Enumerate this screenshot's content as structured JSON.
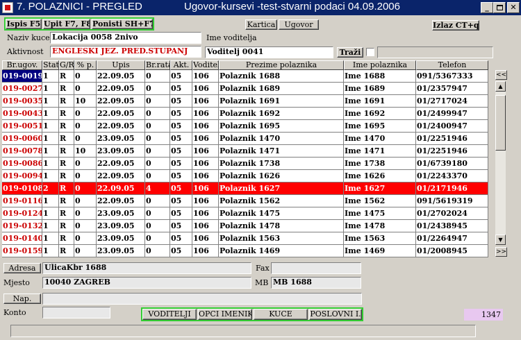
{
  "window": {
    "title_left": "7. POLAZNICI - PREGLED",
    "title_right": "Ugovor-kursevi -test-stvarni podaci 04.09.2006",
    "min_label": "_",
    "max_label": "□",
    "close_label": "✕"
  },
  "toolbar": {
    "ispis": "Ispis F5",
    "upit": "Upit F7, F8",
    "ponisti": "Ponisti SH+F7",
    "kartica": "Kartica",
    "ugovor": "Ugovor",
    "izlaz": "Izlaz CT+q"
  },
  "header_form": {
    "naziv_kuce_label": "Naziv kuce",
    "naziv_kuce_value": "Lokacija 0058 2nivo",
    "ime_voditelja_label": "Ime voditelja",
    "aktivnost_label": "Aktivnost",
    "aktivnost_value": "ENGLESKI JEZ. PRED.STUPANJ",
    "voditelj_value": "Voditelj 0041",
    "trazi_label": "Traži"
  },
  "table": {
    "columns": [
      "Br.ugov.",
      "Stat.",
      "G/R",
      "% p.",
      "Upis",
      "Br.rata",
      "Akt.",
      "Voditelj",
      "Prezime polaznika",
      "Ime polaznika",
      "Telefon"
    ],
    "rows": [
      [
        "019-0019",
        "1",
        "R",
        "0",
        "22.09.05",
        "0",
        "05",
        "106",
        "Polaznik 1688",
        "Ime 1688",
        "091/5367333"
      ],
      [
        "019-0027",
        "1",
        "R",
        "0",
        "22.09.05",
        "0",
        "05",
        "106",
        "Polaznik 1689",
        "Ime 1689",
        "01/2357947"
      ],
      [
        "019-0035",
        "1",
        "R",
        "10",
        "22.09.05",
        "0",
        "05",
        "106",
        "Polaznik 1691",
        "Ime 1691",
        "01/2717024"
      ],
      [
        "019-0043",
        "1",
        "R",
        "0",
        "22.09.05",
        "0",
        "05",
        "106",
        "Polaznik 1692",
        "Ime 1692",
        "01/2499947"
      ],
      [
        "019-0051",
        "1",
        "R",
        "0",
        "22.09.05",
        "0",
        "05",
        "106",
        "Polaznik 1695",
        "Ime 1695",
        "01/2400947"
      ],
      [
        "019-0060",
        "1",
        "R",
        "0",
        "23.09.05",
        "0",
        "05",
        "106",
        "Polaznik 1470",
        "Ime 1470",
        "01/2251946"
      ],
      [
        "019-0078",
        "1",
        "R",
        "10",
        "23.09.05",
        "0",
        "05",
        "106",
        "Polaznik 1471",
        "Ime 1471",
        "01/2251946"
      ],
      [
        "019-0086",
        "1",
        "R",
        "0",
        "22.09.05",
        "0",
        "05",
        "106",
        "Polaznik 1738",
        "Ime 1738",
        "01/6739180"
      ],
      [
        "019-0094",
        "1",
        "R",
        "0",
        "22.09.05",
        "0",
        "05",
        "106",
        "Polaznik 1626",
        "Ime 1626",
        "01/2243370"
      ],
      [
        "019-0108",
        "2",
        "R",
        "0",
        "22.09.05",
        "4",
        "05",
        "106",
        "Polaznik 1627",
        "Ime 1627",
        "01/2171946"
      ],
      [
        "019-0116",
        "1",
        "R",
        "0",
        "22.09.05",
        "0",
        "05",
        "106",
        "Polaznik 1562",
        "Ime 1562",
        "091/5619319"
      ],
      [
        "019-0124",
        "1",
        "R",
        "0",
        "23.09.05",
        "0",
        "05",
        "106",
        "Polaznik 1475",
        "Ime 1475",
        "01/2702024"
      ],
      [
        "019-0132",
        "1",
        "R",
        "0",
        "23.09.05",
        "0",
        "05",
        "106",
        "Polaznik 1478",
        "Ime 1478",
        "01/2438945"
      ],
      [
        "019-0140",
        "1",
        "R",
        "0",
        "23.09.05",
        "0",
        "05",
        "106",
        "Polaznik 1563",
        "Ime 1563",
        "01/2264947"
      ],
      [
        "019-0159",
        "1",
        "R",
        "0",
        "23.09.05",
        "0",
        "05",
        "106",
        "Polaznik 1469",
        "Ime 1469",
        "01/2008945"
      ]
    ],
    "selected_row_index": 9,
    "current_cell_row_index": 0,
    "scroll_up_label": "<<",
    "scroll_down_label": ">>"
  },
  "detail": {
    "adresa_label": "Adresa",
    "adresa_value": "UlicaKbr 1688",
    "fax_label": "Fax",
    "fax_value": "",
    "mjesto_label": "Mjesto",
    "mjesto_value": "10040 ZAGREB",
    "mb_label": "MB",
    "mb_value": "MB 1688",
    "nap_label": "Nap.",
    "nap_value": "",
    "konto_label": "Konto",
    "konto_value": ""
  },
  "bottom_buttons": {
    "voditelji": "VODITELJI",
    "opci_imenik": "OPCI IMENIK",
    "kuce": "KUCE",
    "poslovni": "POSLOVNI I."
  },
  "counter": "1347",
  "colors": {
    "title_bar": "#0a246a",
    "selected_row": "#ff0000",
    "current_cell": "#000080",
    "key_red": "#cc0000",
    "green_frame": "#33cc33",
    "counter_bg": "#e8c8f0"
  }
}
